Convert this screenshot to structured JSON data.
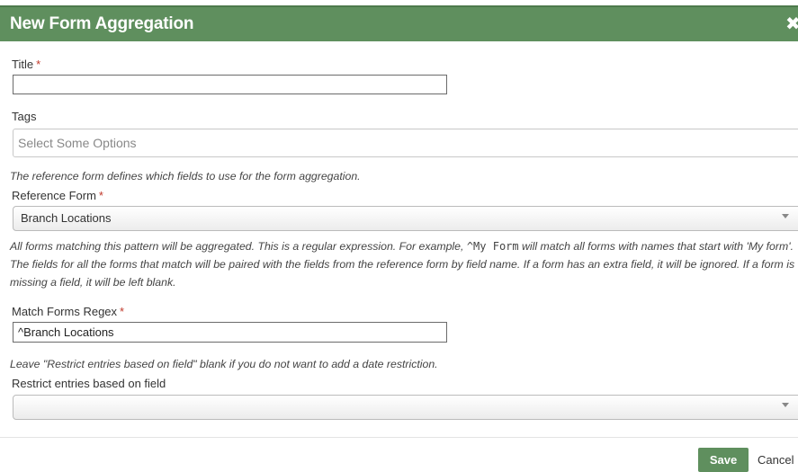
{
  "dialog": {
    "title": "New Form Aggregation",
    "close_glyph": "✖"
  },
  "fields": {
    "title": {
      "label": "Title",
      "required_mark": "*",
      "value": ""
    },
    "tags": {
      "label": "Tags",
      "placeholder": "Select Some Options"
    },
    "reference_help": "The reference form defines which fields to use for the form aggregation.",
    "reference_form": {
      "label": "Reference Form",
      "required_mark": "*",
      "selected": "Branch Locations"
    },
    "regex_help": {
      "part1": "All forms matching this pattern will be aggregated. This is a regular expression. For example, ",
      "code": "^My Form",
      "part2": " will match all forms with names that start with 'My form'. The fields for all the forms that match will be paired with the fields from the reference form by field name. If a form has an extra field, it will be ignored. If a form is missing a field, it will be left blank."
    },
    "match_regex": {
      "label": "Match Forms Regex",
      "required_mark": "*",
      "value": "^Branch Locations"
    },
    "restrict_help": "Leave \"Restrict entries based on field\" blank if you do not want to add a date restriction.",
    "restrict_field": {
      "label": "Restrict entries based on field",
      "selected": ""
    }
  },
  "footer": {
    "save_label": "Save",
    "cancel_label": "Cancel"
  },
  "colors": {
    "header_green": "#5f8f5e",
    "required_red": "#c0392b"
  }
}
